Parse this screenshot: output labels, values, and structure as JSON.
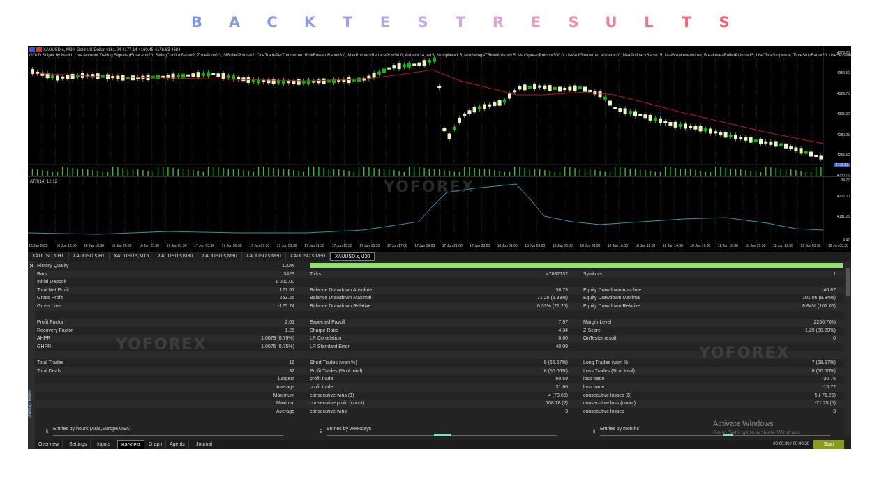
{
  "title": {
    "letters": [
      {
        "ch": "B",
        "color": "#7f96e4"
      },
      {
        "ch": "A",
        "color": "#8698e2"
      },
      {
        "ch": "C",
        "color": "#8e9ae3"
      },
      {
        "ch": "K",
        "color": "#959ce2"
      },
      {
        "ch": "T",
        "color": "#a1a0e3"
      },
      {
        "ch": "E",
        "color": "#b1a4e2"
      },
      {
        "ch": "S",
        "color": "#c2a8e1"
      },
      {
        "ch": "T",
        "color": "#d2aadb"
      },
      {
        "ch": "R",
        "color": "#dea4cf"
      },
      {
        "ch": "E",
        "color": "#e59bbe"
      },
      {
        "ch": "S",
        "color": "#eb8fac"
      },
      {
        "ch": "U",
        "color": "#ee8099"
      },
      {
        "ch": "L",
        "color": "#ef7488"
      },
      {
        "ch": "T",
        "color": "#ee6a78"
      },
      {
        "ch": "S",
        "color": "#ef5f6c"
      }
    ]
  },
  "chart": {
    "symbol_line": "XAUUSD.s, M30:  Gold US Dollar  4161.94 4177.14 4160.45 4176.63  4684",
    "ea_line": "GOLD Sniper by Nadim Live Account Trailing Signals (EmaLen=20; SwingConfirmBars=2; ZonePct=0.3; SlBufferPoints=2; OneTradePerTrend=true; RiskRewardRatio=3.0; MaxPullbackRetracePct=50.0; AtrLen=14; AtrSLMultiplier=1.5; MinSwingATRMultiplier=0.5; MaxSpreadPoints=300.0; UseVolFilter=true; VolLen=20; MaxPullbackBars=15; UseBreakeven=true; BreakevenBufferPoints=15; UseTimeStop=true; TimeStopBars=20; UseSession=",
    "atr_label": "ATR(14) 12.12",
    "price_scale": [
      "4379.25",
      "4354.50",
      "4329.75",
      "4305.00",
      "4280.25",
      "4255.50",
      "4230.75",
      "4206.00",
      "4181.25"
    ],
    "current_price": "4176.63",
    "atr_scale_top": "34.77",
    "atr_scale_bottom": "4.47",
    "x_labels": [
      "16 Jun 2025",
      "16 Jun 16:30",
      "16 Jun 18:30",
      "16 Jun 20:30",
      "16 Jun 22:30",
      "17 Jun 01:30",
      "17 Jun 03:30",
      "17 Jun 05:30",
      "17 Jun 07:30",
      "17 Jun 09:30",
      "17 Jun 11:30",
      "17 Jun 13:30",
      "17 Jun 15:30",
      "17 Jun 17:00",
      "17 Jun 19:00",
      "17 Jun 21:00",
      "17 Jun 23:00",
      "18 Jun 01:00",
      "18 Jun 03:00",
      "18 Jun 06:30",
      "18 Jun 08:30",
      "18 Jun 10:30",
      "18 Jun 12:30",
      "18 Jun 14:30",
      "18 Jun 16:30",
      "18 Jun 18:30",
      "18 Jun 20:30",
      "18 Jun 22:30",
      "19 Jun 01:30",
      "19 Jun 03:30"
    ],
    "colors": {
      "bull": "#e8f7c0",
      "bear": "#00c400",
      "ema": "#c11515",
      "atr": "#2a9ab0",
      "volume": "#22c922",
      "grid": "#3d3d3d"
    },
    "watermark": "YOFOREX"
  },
  "symbol_tabs": [
    "XAUUSD.s,H1",
    "XAUUSD.s,H1",
    "XAUUSD.s,M15",
    "XAUUSD.s,M30",
    "XAUUSD.s,M30",
    "XAUUSD.s,M30",
    "XAUUSD.s,M30",
    "XAUUSD.s,M30"
  ],
  "report": {
    "rows": [
      {
        "c1": "History Quality",
        "v1": "100%",
        "c2": "",
        "v2": "",
        "c3": "",
        "v3": ""
      },
      {
        "c1": "Bars",
        "v1": "3429",
        "c2": "Ticks",
        "v2": "47832132",
        "c3": "Symbols",
        "v3": "1"
      },
      {
        "c1": "Initial Deposit",
        "v1": "1 000.00",
        "c2": "",
        "v2": "",
        "c3": "",
        "v3": ""
      },
      {
        "c1": "Total Net Profit",
        "v1": "127.51",
        "c2": "Balance Drawdown Absolute",
        "v2": "36.73",
        "c3": "Equity Drawdown Absolute",
        "v3": "46.87"
      },
      {
        "c1": "Gross Profit",
        "v1": "253.25",
        "c2": "Balance Drawdown Maximal",
        "v2": "71.25 (6.33%)",
        "c3": "Equity Drawdown Maximal",
        "v3": "101.06 (8.84%)"
      },
      {
        "c1": "Gross Loss",
        "v1": "-125.74",
        "c2": "Balance Drawdown Relative",
        "v2": "6.33% (71.25)",
        "c3": "Equity Drawdown Relative",
        "v3": "8.84% (101.06)"
      },
      {
        "c1": "",
        "v1": "",
        "c2": "",
        "v2": "",
        "c3": "",
        "v3": ""
      },
      {
        "c1": "Profit Factor",
        "v1": "2.01",
        "c2": "Expected Payoff",
        "v2": "7.97",
        "c3": "Margin Level",
        "v3": "2256.70%"
      },
      {
        "c1": "Recovery Factor",
        "v1": "1.26",
        "c2": "Sharpe Ratio",
        "v2": "4.34",
        "c3": "Z-Score",
        "v3": "-1.29 (80.29%)"
      },
      {
        "c1": "AHPR",
        "v1": "1.0079 (0.79%)",
        "c2": "LR Correlation",
        "v2": "0.60",
        "c3": "OnTester result",
        "v3": "0"
      },
      {
        "c1": "GHPR",
        "v1": "1.0075 (0.75%)",
        "c2": "LR Standard Error",
        "v2": "40.09",
        "c3": "",
        "v3": ""
      },
      {
        "c1": "",
        "v1": "",
        "c2": "",
        "v2": "",
        "c3": "",
        "v3": ""
      },
      {
        "c1": "Total Trades",
        "v1": "16",
        "c2": "Short Trades (won %)",
        "v2": "9 (66.67%)",
        "c3": "Long Trades (won %)",
        "v3": "7 (28.57%)"
      },
      {
        "c1": "Total Deals",
        "v1": "32",
        "c2": "Profit Trades (% of total)",
        "v2": "8 (50.00%)",
        "c3": "Loss Trades (% of total)",
        "v3": "8 (50.00%)"
      },
      {
        "c1": "",
        "v1": "Largest",
        "c2": "profit trade",
        "v2": "60.59",
        "c3": "loss trade",
        "v3": "-20.76"
      },
      {
        "c1": "",
        "v1": "Average",
        "c2": "profit trade",
        "v2": "31.66",
        "c3": "loss trade",
        "v3": "-15.72"
      },
      {
        "c1": "",
        "v1": "Maximum",
        "c2": "consecutive wins ($)",
        "v2": "4 (73.65)",
        "c3": "consecutive losses ($)",
        "v3": "5 (-71.25)"
      },
      {
        "c1": "",
        "v1": "Maximal",
        "c2": "consecutive profit (count)",
        "v2": "108.78 (2)",
        "c3": "consecutive loss (count)",
        "v3": "-71.25 (5)"
      },
      {
        "c1": "",
        "v1": "Average",
        "c2": "consecutive wins",
        "v2": "3",
        "c3": "consecutive losses",
        "v3": "3"
      }
    ],
    "entries": [
      {
        "label": "Entries by hours (Asia,Europe,USA)",
        "axis": "5"
      },
      {
        "label": "Entries by weekdays",
        "axis": "5"
      },
      {
        "label": "Entries by months",
        "axis": "8"
      }
    ],
    "bar_color": "#8fe46b"
  },
  "side_title": "Strategy Tester",
  "bottom_tabs": [
    "Overview",
    "Settings",
    "Inputs",
    "Backtest",
    "Graph",
    "Agents",
    "Journal"
  ],
  "active_bottom_tab": "Backtest",
  "timer": "00:00:30 / 00:00:30",
  "start_label": "Start",
  "activate": {
    "line1": "Activate Windows",
    "line2": "Go to Settings to activate Windows."
  }
}
